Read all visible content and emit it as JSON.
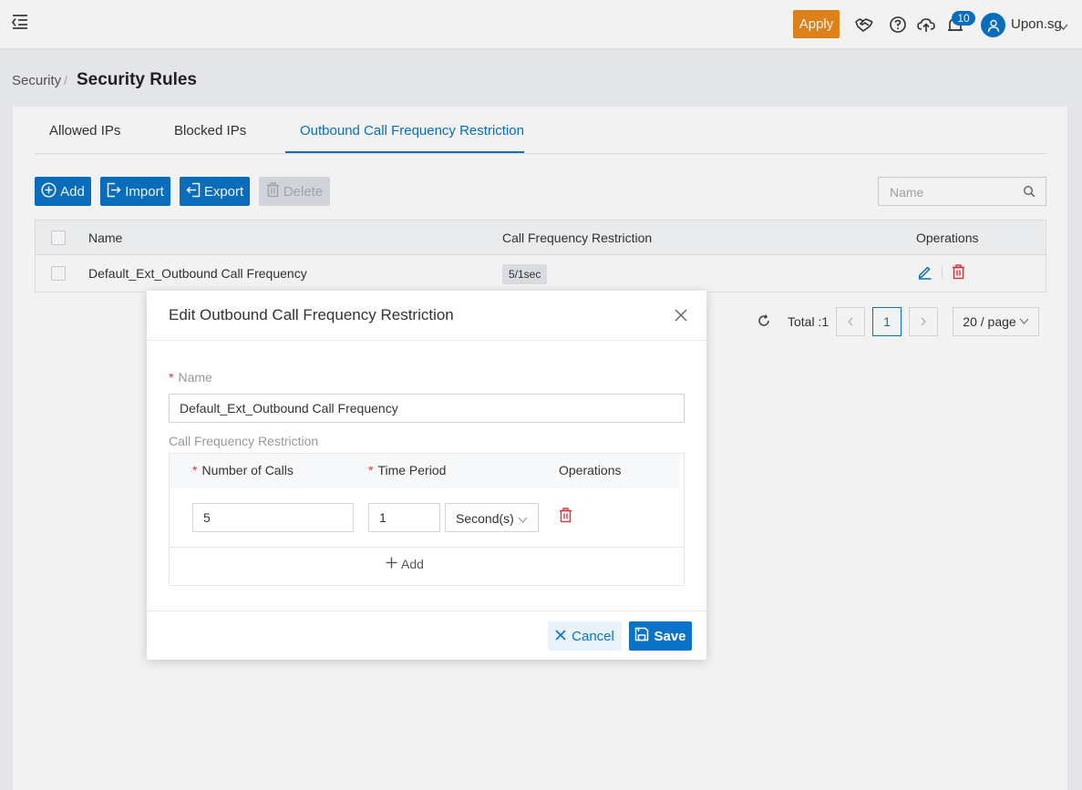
{
  "header": {
    "apply_label": "Apply",
    "notification_count": "10",
    "user_name": "Upon.sg",
    "icons": [
      "menu-toggle-icon",
      "handshake-icon",
      "help-icon",
      "cloud-upload-icon",
      "notification-icon",
      "user-icon",
      "chevron-down-icon"
    ],
    "accent_color": "#0a73c7",
    "apply_color": "#e88a1a"
  },
  "breadcrumb": {
    "parent": "Security",
    "separator": "/",
    "current": "Security Rules"
  },
  "tabs": [
    {
      "label": "Allowed IPs",
      "active": false
    },
    {
      "label": "Blocked IPs",
      "active": false
    },
    {
      "label": "Outbound Call Frequency Restriction",
      "active": true
    }
  ],
  "toolbar": {
    "add_label": "Add",
    "import_label": "Import",
    "export_label": "Export",
    "delete_label": "Delete",
    "search_placeholder": "Name"
  },
  "table": {
    "columns": [
      "Name",
      "Call Frequency Restriction",
      "Operations"
    ],
    "rows": [
      {
        "name": "Default_Ext_Outbound Call Frequency",
        "restriction": "5/1sec"
      }
    ]
  },
  "pagination": {
    "total_text": "Total :1",
    "current_page": "1",
    "page_size": "20 / page"
  },
  "modal": {
    "title": "Edit Outbound Call Frequency Restriction",
    "required_mark": "*",
    "name_label": "Name",
    "name_value": "Default_Ext_Outbound Call Frequency",
    "restriction_label": "Call Frequency Restriction",
    "columns": [
      "Number of Calls",
      "Time Period",
      "Operations"
    ],
    "row": {
      "calls": "5",
      "period": "1",
      "unit": "Second(s)"
    },
    "add_label": "Add",
    "cancel_label": "Cancel",
    "save_label": "Save"
  }
}
